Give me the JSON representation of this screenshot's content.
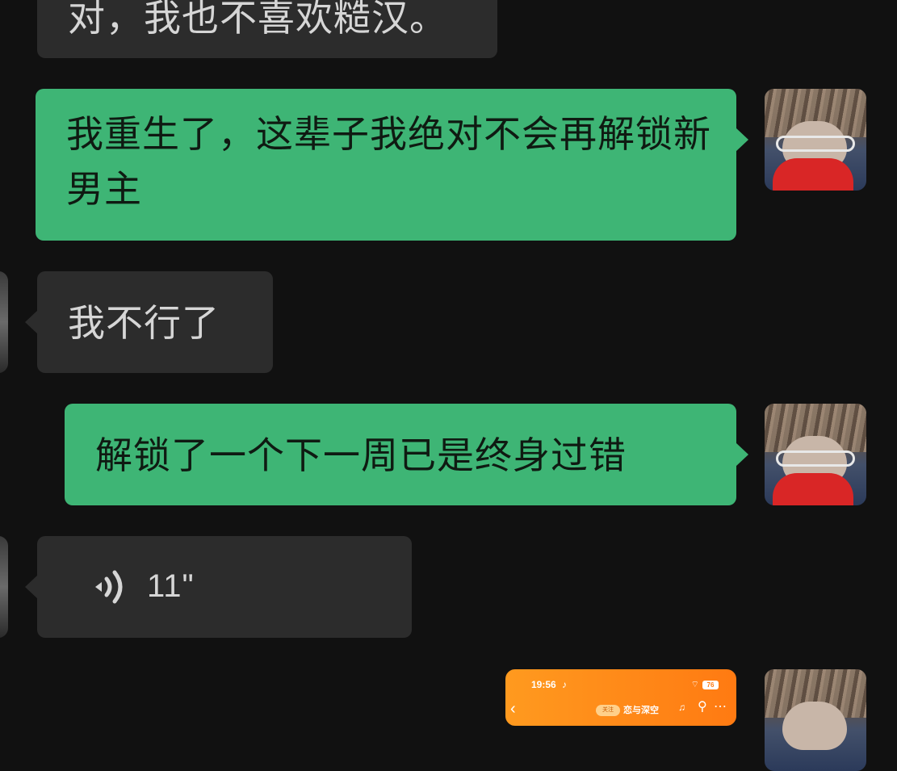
{
  "messages": [
    {
      "side": "in",
      "text": "对，我也不喜欢糙汉。"
    },
    {
      "side": "out",
      "text": "我重生了，这辈子我绝对不会再解锁新男主"
    },
    {
      "side": "in",
      "text": "我不行了"
    },
    {
      "side": "out",
      "text": "解锁了一个下一周已是终身过错"
    },
    {
      "side": "in",
      "type": "voice",
      "duration": "11\""
    },
    {
      "side": "out",
      "type": "image"
    }
  ],
  "shared_screenshot": {
    "time": "19:56",
    "battery": "76",
    "back_glyph": "‹",
    "chip": "关注",
    "title": "恋与深空",
    "menu_glyph": "⋯"
  },
  "colors": {
    "background": "#111111",
    "incoming_bubble": "#2c2c2c",
    "outgoing_bubble": "#3eb575"
  },
  "icons": [
    "voice-wave-icon",
    "self-avatar",
    "peer-avatar"
  ]
}
